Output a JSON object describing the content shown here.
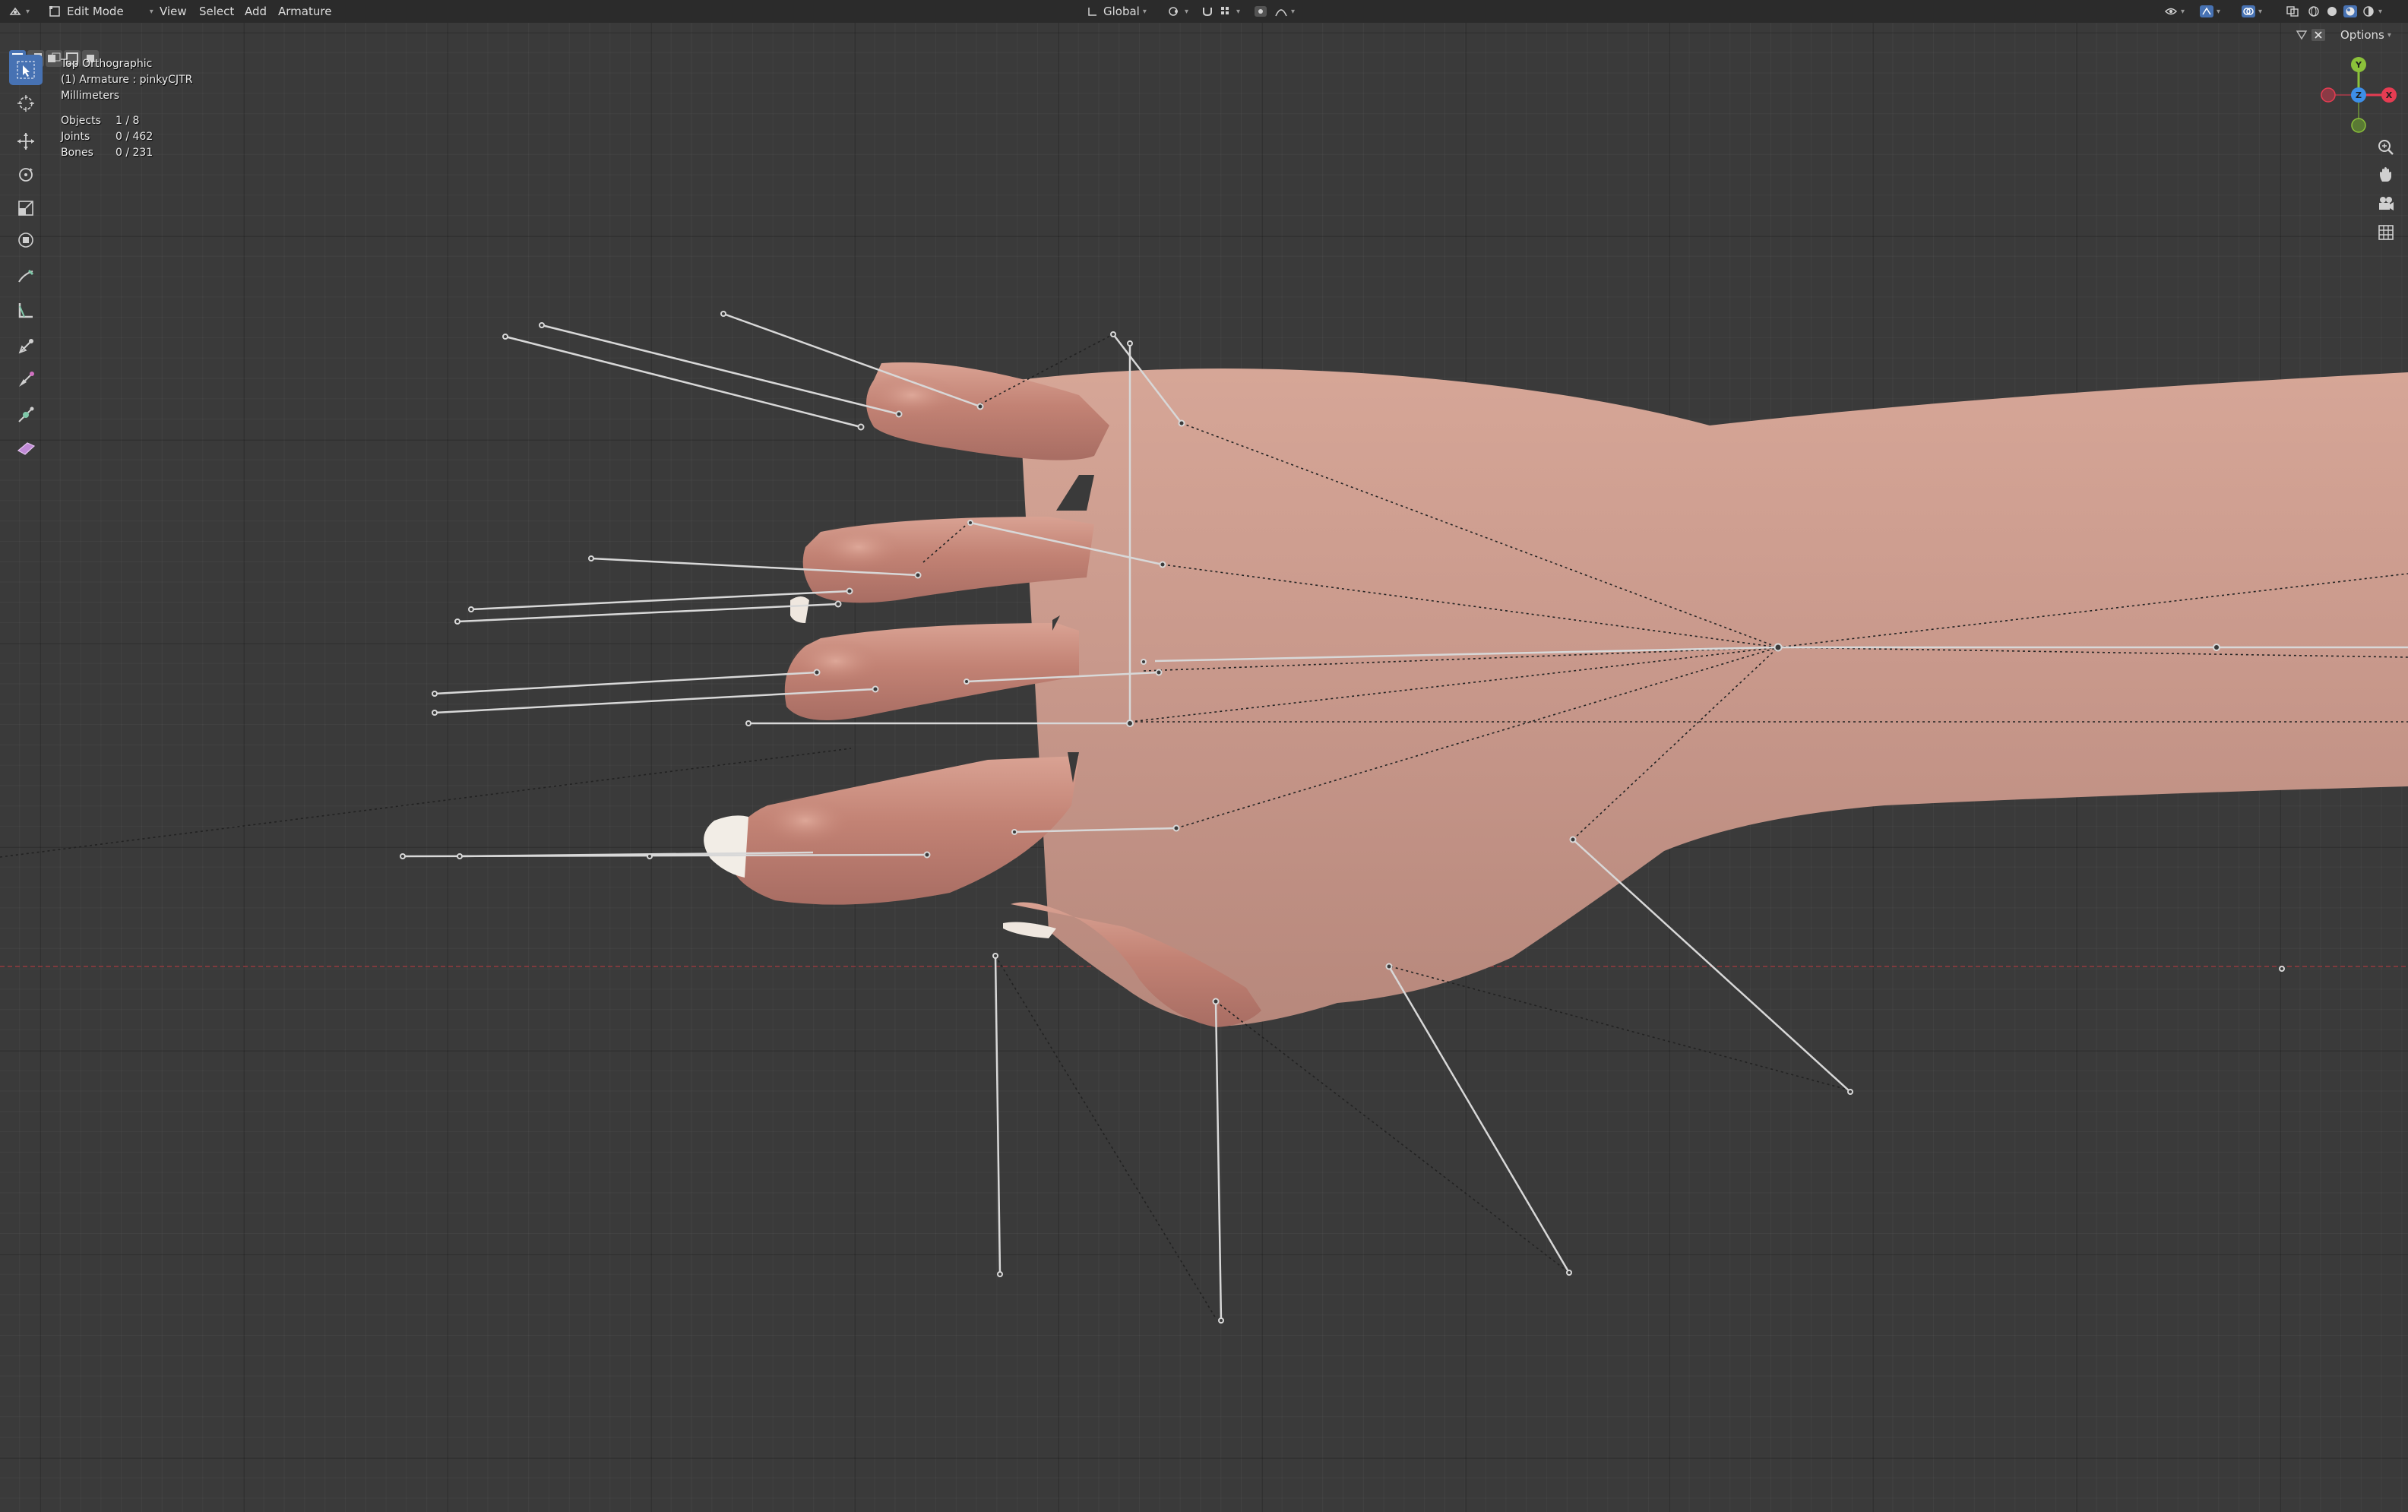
{
  "header": {
    "mode": "Edit Mode",
    "menus": [
      "View",
      "Select",
      "Add",
      "Armature"
    ],
    "orientation": "Global",
    "options_label": "Options"
  },
  "overlay": {
    "view_name": "Top Orthographic",
    "object_name": "(1) Armature : pinkyCJTR",
    "units": "Millimeters",
    "stats": [
      {
        "label": "Objects",
        "value": "1 / 8"
      },
      {
        "label": "Joints",
        "value": "0 / 462"
      },
      {
        "label": "Bones",
        "value": "0 / 231"
      }
    ]
  },
  "toolbar": {
    "tools": [
      "select-box-tool",
      "cursor-tool",
      "move-tool",
      "rotate-tool",
      "scale-tool",
      "transform-tool",
      "annotate-tool",
      "measure-tool",
      "extrude-tool",
      "bone-size-tool",
      "roll-tool",
      "envelope-tool"
    ],
    "active_tool": "select-box-tool"
  },
  "gizmo": {
    "axes": [
      "Y",
      "Z",
      "X"
    ]
  },
  "colors": {
    "header_bg": "#2b2b2b",
    "viewport_bg": "#3a3a3a",
    "active_blue": "#4772b3",
    "axis_x": "#e63c52",
    "axis_y": "#8bc13a",
    "axis_z": "#3d8fe8",
    "skin": "#c98a7d"
  }
}
